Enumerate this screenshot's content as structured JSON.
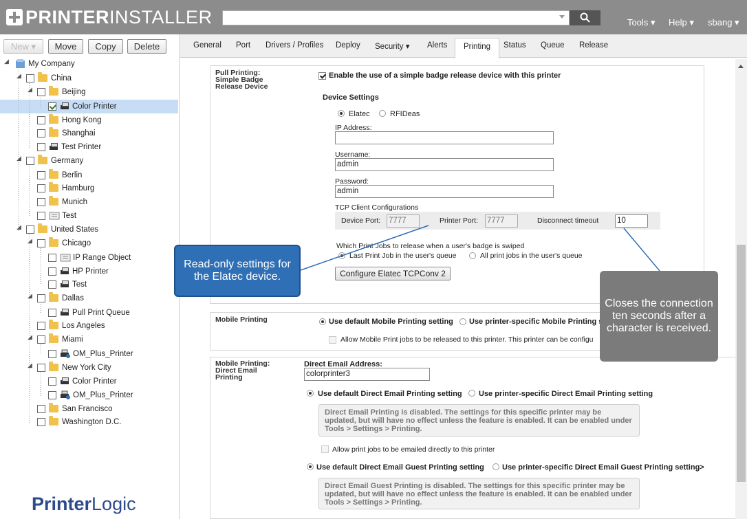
{
  "app": {
    "title_bold": "PRINTER",
    "title_thin": "INSTALLER"
  },
  "header": {
    "menus": [
      "Tools ▾",
      "Help ▾",
      "sbang ▾"
    ]
  },
  "sidebar": {
    "buttons": {
      "new": "New ▾",
      "move": "Move",
      "copy": "Copy",
      "delete": "Delete"
    },
    "tree": [
      {
        "label": "My Company",
        "icon": "globe-icon"
      },
      {
        "label": "China",
        "icon": "folder-icon"
      },
      {
        "label": "Beijing",
        "icon": "folder-icon"
      },
      {
        "label": "Color Printer",
        "icon": "printer-icon"
      },
      {
        "label": "Hong Kong",
        "icon": "folder-icon"
      },
      {
        "label": "Shanghai",
        "icon": "folder-icon"
      },
      {
        "label": "Test Printer",
        "icon": "printer-icon"
      },
      {
        "label": "Germany",
        "icon": "folder-icon"
      },
      {
        "label": "Berlin",
        "icon": "folder-icon"
      },
      {
        "label": "Hamburg",
        "icon": "folder-icon"
      },
      {
        "label": "Munich",
        "icon": "folder-icon"
      },
      {
        "label": "Test",
        "icon": "ip-range-icon"
      },
      {
        "label": "United States",
        "icon": "folder-icon"
      },
      {
        "label": "Chicago",
        "icon": "folder-icon"
      },
      {
        "label": "IP Range Object",
        "icon": "ip-range-icon"
      },
      {
        "label": "HP Printer",
        "icon": "printer-icon"
      },
      {
        "label": "Test",
        "icon": "printer-icon"
      },
      {
        "label": "Dallas",
        "icon": "folder-icon"
      },
      {
        "label": "Pull Print Queue",
        "icon": "printer-icon"
      },
      {
        "label": "Los Angeles",
        "icon": "folder-icon"
      },
      {
        "label": "Miami",
        "icon": "folder-icon"
      },
      {
        "label": "OM_Plus_Printer",
        "icon": "om-printer-icon"
      },
      {
        "label": "New York City",
        "icon": "folder-icon"
      },
      {
        "label": "Color Printer",
        "icon": "printer-icon"
      },
      {
        "label": "OM_Plus_Printer",
        "icon": "om-printer-icon"
      },
      {
        "label": "San Francisco",
        "icon": "folder-icon"
      },
      {
        "label": "Washington D.C.",
        "icon": "folder-icon"
      }
    ],
    "brand_bold": "Printer",
    "brand_thin": "Logic"
  },
  "tabs": [
    "General",
    "Port",
    "Drivers / Profiles",
    "Deploy",
    "Security ▾",
    "Alerts",
    "Printing",
    "Status",
    "Queue",
    "Release"
  ],
  "pull_printing": {
    "section_label": "Pull Printing: Simple Badge Release Device",
    "enable_label": "Enable the use of a simple badge release device with this printer",
    "device_settings": "Device Settings",
    "radio_elatec": "Elatec",
    "radio_rfideas": "RFIDeas",
    "ip_label": "IP Address:",
    "ip_value": "",
    "username_label": "Username:",
    "username_value": "admin",
    "password_label": "Password:",
    "password_value": "admin",
    "tcp_label": "TCP Client Configurations",
    "device_port_label": "Device Port:",
    "device_port_value": "7777",
    "printer_port_label": "Printer Port:",
    "printer_port_value": "7777",
    "disconnect_label": "Disconnect timeout",
    "disconnect_value": "10",
    "which_jobs": "Which Print Jobs to release when a user's badge is swiped",
    "last_job": "Last Print Job in the user's queue",
    "all_jobs": "All print jobs in the user's queue",
    "configure_btn": "Configure Elatec TCPConv 2"
  },
  "mobile_printing": {
    "section_label": "Mobile Printing",
    "default_setting": "Use default Mobile Printing setting",
    "specific_setting": "Use printer-specific Mobile Printing s",
    "allow_label": "Allow Mobile Print jobs to be released to this printer. This printer can be configu"
  },
  "email_printing": {
    "section_label": "Mobile Printing: Direct Email Printing",
    "address_label": "Direct Email Address:",
    "address_value": "colorprinter3",
    "default_setting": "Use default Direct Email Printing setting",
    "specific_setting": "Use printer-specific Direct Email Printing setting",
    "disabled_note": "Direct Email Printing is disabled. The settings for this specific printer may be updated, but will have no effect unless the feature is enabled. It can be enabled under Tools > Settings > Printing.",
    "allow_label": "Allow print jobs to be emailed directly to this printer",
    "guest_default": "Use default Direct Email Guest Printing setting",
    "guest_specific": "Use printer-specific Direct Email Guest Printing setting>",
    "guest_note": "Direct Email Guest Printing is disabled. The settings for this specific printer may be updated, but will have no effect unless the feature is enabled. It can be enabled under Tools > Settings > Printing."
  },
  "callouts": {
    "blue": "Read-only settings for the Elatec device.",
    "gray": "Closes the connection ten seconds after a character is received."
  }
}
